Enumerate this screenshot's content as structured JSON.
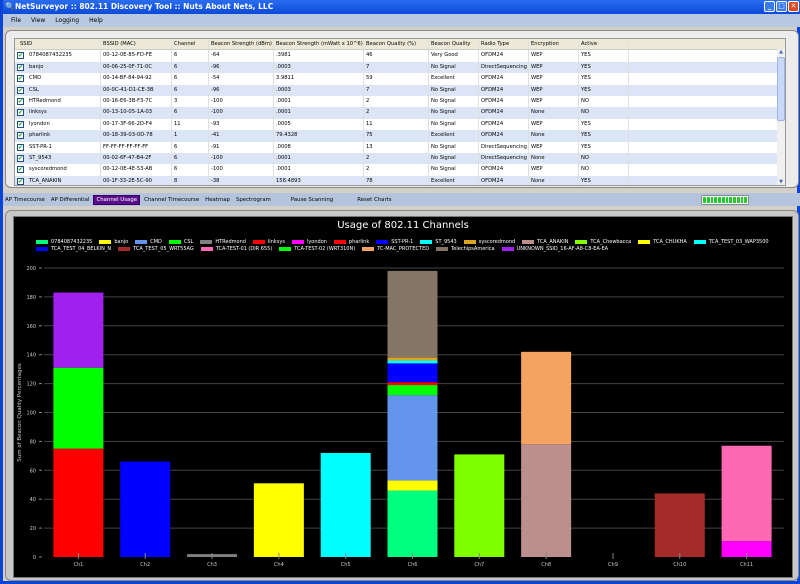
{
  "window": {
    "title": "NetSurveyor :: 802.11 Discovery Tool :: Nuts About Nets, LLC",
    "minimize": "_",
    "maximize": "□",
    "close": "✕"
  },
  "menu": [
    "File",
    "View",
    "Logging",
    "Help"
  ],
  "table": {
    "columns": [
      "SSID",
      "BSSID (MAC)",
      "Channel",
      "Beacon Strength (dBm)",
      "Beacon Strength (mWatt x 10^6)",
      "Beacon Quality (%)",
      "Beacon Quality",
      "Radio Type",
      "Encryption",
      "Active"
    ],
    "rows": [
      [
        "0784087432235",
        "00-12-0E-85-FD-FE",
        "6",
        "-64",
        ".3981",
        "46",
        "Very Good",
        "OFDM24",
        "WEP",
        "YES"
      ],
      [
        "banjo",
        "00-06-25-0F-71-0C",
        "6",
        "-96",
        ".0003",
        "7",
        "No Signal",
        "DirectSequencing",
        "WEP",
        "YES"
      ],
      [
        "CMD",
        "00-14-BF-84-94-92",
        "6",
        "-54",
        "3.9811",
        "59",
        "Excellent",
        "OFDM24",
        "WEP",
        "YES"
      ],
      [
        "CSL",
        "00-0C-41-D1-CE-3B",
        "6",
        "-96",
        ".0003",
        "7",
        "No Signal",
        "OFDM24",
        "WEP",
        "YES"
      ],
      [
        "HTRedmond",
        "00-16-E6-3B-F3-7C",
        "3",
        "-100",
        ".0001",
        "2",
        "No Signal",
        "OFDM24",
        "WEP",
        "NO"
      ],
      [
        "linksys",
        "00-13-10-05-1A-03",
        "6",
        "-100",
        ".0001",
        "2",
        "No Signal",
        "OFDM24",
        "None",
        "NO"
      ],
      [
        "lyondon",
        "00-17-3F-66-2D-F4",
        "11",
        "-93",
        ".0005",
        "11",
        "No Signal",
        "OFDM24",
        "WEP",
        "YES"
      ],
      [
        "pharlink",
        "00-18-39-03-0D-78",
        "1",
        "-41",
        "79.4328",
        "75",
        "Excellent",
        "OFDM24",
        "None",
        "YES"
      ],
      [
        "SST-PR-1",
        "FF-FF-FF-FF-FF-FF",
        "6",
        "-91",
        ".0008",
        "13",
        "No Signal",
        "DirectSequencing",
        "WEP",
        "YES"
      ],
      [
        "ST_9543",
        "00-02-6F-47-B4-2F",
        "6",
        "-100",
        ".0001",
        "2",
        "No Signal",
        "DirectSequencing",
        "None",
        "NO"
      ],
      [
        "syscoredmond",
        "00-12-0E-4E-53-AB",
        "6",
        "-100",
        ".0001",
        "2",
        "No Signal",
        "OFDM24",
        "WEP",
        "NO"
      ],
      [
        "TCA_ANAKIN",
        "00-1F-33-2E-5C-90",
        "8",
        "-38",
        "158.4893",
        "78",
        "Excellent",
        "OFDM24",
        "None",
        "YES"
      ]
    ]
  },
  "toolbar": {
    "items": [
      "AP Timecourse",
      "AP Differential",
      "Channel Usage",
      "Channel Timecourse",
      "Heatmap",
      "Spectrogram"
    ],
    "active": "Channel Usage",
    "pause": "Pause Scanning",
    "reset": "Reset Charts"
  },
  "scan_activity": 1.0,
  "chart_data": {
    "type": "bar",
    "stacked": true,
    "title": "Usage of 802.11 Channels",
    "xlabel": "",
    "ylabel": "Sum of Beacon Quality Percentages",
    "ylim": [
      0,
      200
    ],
    "yticks": [
      0,
      20,
      40,
      60,
      80,
      100,
      120,
      140,
      160,
      180,
      200
    ],
    "grid": true,
    "legend": "top",
    "categories": [
      "Ch1",
      "Ch2",
      "Ch3",
      "Ch4",
      "Ch5",
      "Ch6",
      "Ch7",
      "Ch8",
      "Ch9",
      "Ch10",
      "Ch11"
    ],
    "series": [
      {
        "name": "0784087432235",
        "color": "#00ff7f",
        "values": [
          0,
          0,
          0,
          0,
          0,
          46,
          0,
          0,
          0,
          0,
          0
        ]
      },
      {
        "name": "banjo",
        "color": "#ffff00",
        "values": [
          0,
          0,
          0,
          0,
          0,
          7,
          0,
          0,
          0,
          0,
          0
        ]
      },
      {
        "name": "CMD",
        "color": "#6495ed",
        "values": [
          0,
          0,
          0,
          0,
          0,
          59,
          0,
          0,
          0,
          0,
          0
        ]
      },
      {
        "name": "CSL",
        "color": "#00ff00",
        "values": [
          0,
          0,
          0,
          0,
          0,
          7,
          0,
          0,
          0,
          0,
          0
        ]
      },
      {
        "name": "HTRedmond",
        "color": "#808080",
        "values": [
          0,
          0,
          2,
          0,
          0,
          0,
          0,
          0,
          0,
          0,
          0
        ]
      },
      {
        "name": "linksys",
        "color": "#ff0000",
        "values": [
          0,
          0,
          0,
          0,
          0,
          2,
          0,
          0,
          0,
          0,
          0
        ]
      },
      {
        "name": "lyondon",
        "color": "#ff00ff",
        "values": [
          0,
          0,
          0,
          0,
          0,
          0,
          0,
          0,
          0,
          0,
          11
        ]
      },
      {
        "name": "pharlink",
        "color": "#ff0000",
        "values": [
          75,
          0,
          0,
          0,
          0,
          0,
          0,
          0,
          0,
          0,
          0
        ]
      },
      {
        "name": "SST-PR-1",
        "color": "#0000ff",
        "values": [
          0,
          0,
          0,
          0,
          0,
          13,
          0,
          0,
          0,
          0,
          0
        ]
      },
      {
        "name": "ST_9543",
        "color": "#00ffff",
        "values": [
          0,
          0,
          0,
          0,
          0,
          2,
          0,
          0,
          0,
          0,
          0
        ]
      },
      {
        "name": "syscoredmond",
        "color": "#daa520",
        "values": [
          0,
          0,
          0,
          0,
          0,
          2,
          0,
          0,
          0,
          0,
          0
        ]
      },
      {
        "name": "TCA_ANAKIN",
        "color": "#bc8f8f",
        "values": [
          0,
          0,
          0,
          0,
          0,
          0,
          0,
          78,
          0,
          0,
          0
        ]
      },
      {
        "name": "TCA_Chewbacca",
        "color": "#7fff00",
        "values": [
          0,
          0,
          0,
          0,
          0,
          0,
          71,
          0,
          0,
          0,
          0
        ]
      },
      {
        "name": "TCA_CHUKHA",
        "color": "#ffff00",
        "values": [
          0,
          0,
          0,
          51,
          0,
          0,
          0,
          0,
          0,
          0,
          0
        ]
      },
      {
        "name": "TCA_TEST_03_WAP3500",
        "color": "#00ffff",
        "values": [
          0,
          0,
          0,
          0,
          72,
          0,
          0,
          0,
          0,
          0,
          0
        ]
      },
      {
        "name": "TCA_TEST_04_BELKIN_N",
        "color": "#0000ff",
        "values": [
          0,
          66,
          0,
          0,
          0,
          0,
          0,
          0,
          0,
          0,
          0
        ]
      },
      {
        "name": "TCA_TEST_05_WRT55AG",
        "color": "#a52a2a",
        "values": [
          0,
          0,
          0,
          0,
          0,
          0,
          0,
          0,
          0,
          44,
          0
        ]
      },
      {
        "name": "TCA-TEST-01 (DIR 655)",
        "color": "#ff69b4",
        "values": [
          0,
          0,
          0,
          0,
          0,
          0,
          0,
          0,
          0,
          0,
          66
        ]
      },
      {
        "name": "TCA-TEST-02 (WRT310N)",
        "color": "#00ff00",
        "values": [
          56,
          0,
          0,
          0,
          0,
          0,
          0,
          0,
          0,
          0,
          0
        ]
      },
      {
        "name": "TC-MAC_PROTECTED",
        "color": "#f4a460",
        "values": [
          0,
          0,
          0,
          0,
          0,
          0,
          0,
          64,
          0,
          0,
          0
        ]
      },
      {
        "name": "TelechipsAmerica",
        "color": "#857564",
        "values": [
          0,
          0,
          0,
          0,
          0,
          60,
          0,
          0,
          0,
          0,
          0
        ]
      },
      {
        "name": "UNKNOWN_SSID_16-AF-A8-C8-EA-EA",
        "color": "#a020f0",
        "values": [
          52,
          0,
          0,
          0,
          0,
          0,
          0,
          0,
          0,
          0,
          0
        ]
      }
    ]
  }
}
